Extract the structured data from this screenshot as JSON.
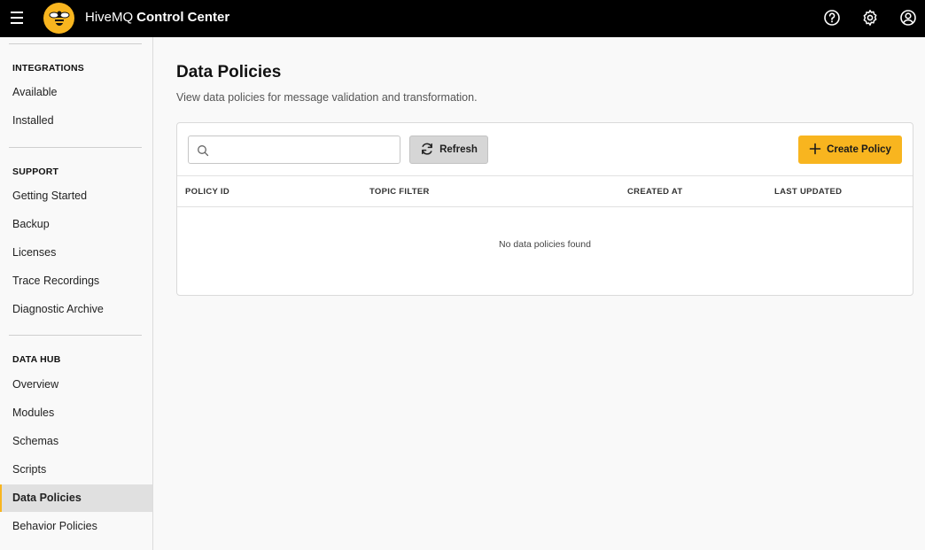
{
  "header": {
    "brand_name": "HiveMQ",
    "brand_product": "Control Center",
    "colors": {
      "bar": "#000000",
      "accent": "#f8b51f"
    },
    "icons": [
      "menu-icon",
      "bee-logo-icon",
      "help-icon",
      "gear-icon",
      "account-icon"
    ]
  },
  "sidebar": {
    "sections": [
      {
        "title": "INTEGRATIONS",
        "items": [
          "Available",
          "Installed"
        ]
      },
      {
        "title": "SUPPORT",
        "items": [
          "Getting Started",
          "Backup",
          "Licenses",
          "Trace Recordings",
          "Diagnostic Archive"
        ]
      },
      {
        "title": "DATA HUB",
        "items": [
          "Overview",
          "Modules",
          "Schemas",
          "Scripts",
          "Data Policies",
          "Behavior Policies"
        ]
      }
    ],
    "active_item": "Data Policies"
  },
  "main": {
    "title": "Data Policies",
    "description": "View data policies for message validation and transformation.",
    "search": {
      "value": "",
      "placeholder": ""
    },
    "refresh_label": "Refresh",
    "create_label": "Create Policy",
    "columns": [
      "POLICY ID",
      "TOPIC FILTER",
      "CREATED AT",
      "LAST UPDATED"
    ],
    "empty_message": "No data policies found"
  }
}
